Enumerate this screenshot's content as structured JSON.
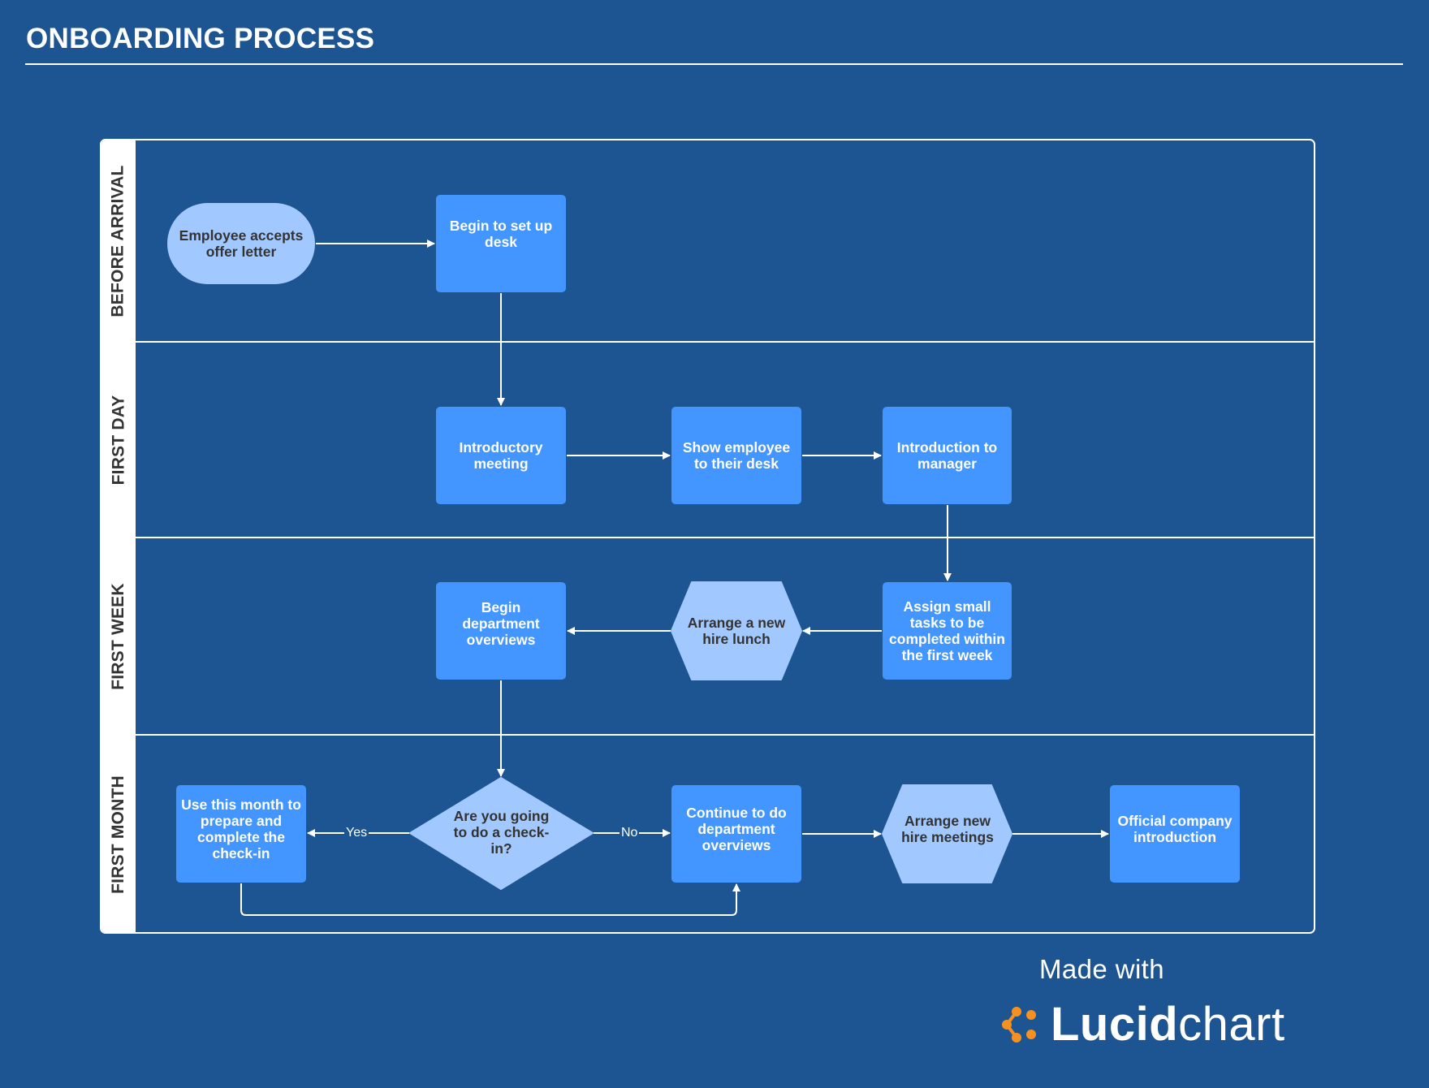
{
  "header": {
    "title": "ONBOARDING PROCESS"
  },
  "lanes": [
    {
      "label": "BEFORE ARRIVAL"
    },
    {
      "label": "FIRST DAY"
    },
    {
      "label": "FIRST WEEK"
    },
    {
      "label": "FIRST MONTH"
    }
  ],
  "nodes": {
    "accept_offer": {
      "label": "Employee accepts offer letter",
      "shape": "terminator"
    },
    "setup_desk": {
      "label": "Begin to set up desk",
      "shape": "process"
    },
    "intro_meeting": {
      "label": "Introductory meeting",
      "shape": "process"
    },
    "show_desk": {
      "label": "Show employee to their desk",
      "shape": "process"
    },
    "intro_manager": {
      "label": "Introduction to manager",
      "shape": "process"
    },
    "assign_tasks": {
      "label": "Assign small tasks to be completed within the first week",
      "shape": "process"
    },
    "hire_lunch": {
      "label": "Arrange a new hire lunch",
      "shape": "hexagon"
    },
    "dept_overviews": {
      "label": "Begin department overviews",
      "shape": "process"
    },
    "checkin_decision": {
      "label": "Are you going to do a check-in?",
      "shape": "decision"
    },
    "prepare_checkin": {
      "label": "Use this month to prepare and complete the check-in",
      "shape": "process"
    },
    "continue_overviews": {
      "label": "Continue to do department overviews",
      "shape": "process"
    },
    "hire_meetings": {
      "label": "Arrange new hire meetings",
      "shape": "hexagon"
    },
    "company_intro": {
      "label": "Official company introduction",
      "shape": "process"
    }
  },
  "edges": [
    {
      "from": "accept_offer",
      "to": "setup_desk",
      "label": ""
    },
    {
      "from": "setup_desk",
      "to": "intro_meeting",
      "label": ""
    },
    {
      "from": "intro_meeting",
      "to": "show_desk",
      "label": ""
    },
    {
      "from": "show_desk",
      "to": "intro_manager",
      "label": ""
    },
    {
      "from": "intro_manager",
      "to": "assign_tasks",
      "label": ""
    },
    {
      "from": "assign_tasks",
      "to": "hire_lunch",
      "label": ""
    },
    {
      "from": "hire_lunch",
      "to": "dept_overviews",
      "label": ""
    },
    {
      "from": "dept_overviews",
      "to": "checkin_decision",
      "label": ""
    },
    {
      "from": "checkin_decision",
      "to": "prepare_checkin",
      "label": "Yes"
    },
    {
      "from": "checkin_decision",
      "to": "continue_overviews",
      "label": "No"
    },
    {
      "from": "prepare_checkin",
      "to": "continue_overviews",
      "label": ""
    },
    {
      "from": "continue_overviews",
      "to": "hire_meetings",
      "label": ""
    },
    {
      "from": "hire_meetings",
      "to": "company_intro",
      "label": ""
    }
  ],
  "colors": {
    "background": "#1c5591",
    "process": "#4396ff",
    "secondary": "#a2c9ff",
    "text_dark": "#333333",
    "line": "#ffffff",
    "brand_orange": "#f7901e"
  },
  "footer": {
    "made_with": "Made with",
    "brand_bold": "Lucid",
    "brand_light": "chart",
    "brand_icon": "lucidchart-logo-icon"
  }
}
